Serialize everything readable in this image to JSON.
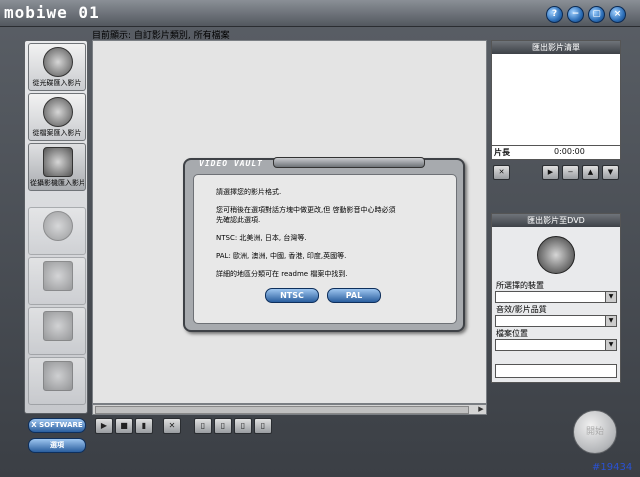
{
  "app": {
    "logo_text": "mobiwe 01"
  },
  "title_buttons": [
    "?",
    "−",
    "▢",
    "×"
  ],
  "breadcrumb": "目前顯示: 自訂影片類別, 所有檔案",
  "left_panel": {
    "buttons": [
      {
        "label": "從光碟匯入影片",
        "state": "normal"
      },
      {
        "label": "從檔案匯入影片",
        "state": "normal"
      },
      {
        "label": "從攝影機匯入影片",
        "state": "active"
      },
      {
        "label": "",
        "state": "disabled"
      },
      {
        "label": "",
        "state": "disabled"
      },
      {
        "label": "",
        "state": "disabled"
      },
      {
        "label": "",
        "state": "disabled"
      }
    ],
    "software_button": "X SOFTWARE",
    "options_button": "選項"
  },
  "playlist": {
    "header": "匯出影片清單",
    "length_label": "片長",
    "length_value": "0:00:00"
  },
  "dvd_export": {
    "header": "匯出影片至DVD",
    "device_label": "所選擇的裝置",
    "quality_label": "音效/影片品質",
    "location_label": "檔案位置"
  },
  "start_button": "開始",
  "dialog": {
    "title": "VIDEO VAULT",
    "lines": [
      "請選擇您的影片格式.",
      "您可稍後在選項對話方塊中做更改,但 啓動影音中心時必須",
      "先確認此選項.",
      "NTSC: 北美洲, 日本, 台灣等.",
      "PAL: 歐洲, 澳洲, 中國, 香港, 印度,英國等.",
      "詳細的地區分類可在 readme 檔案中找到."
    ],
    "ntsc_button": "NTSC",
    "pal_button": "PAL"
  },
  "badge": "#19434",
  "colors": {
    "accent": "#2a5e9e",
    "badge": "#2a52d4"
  }
}
